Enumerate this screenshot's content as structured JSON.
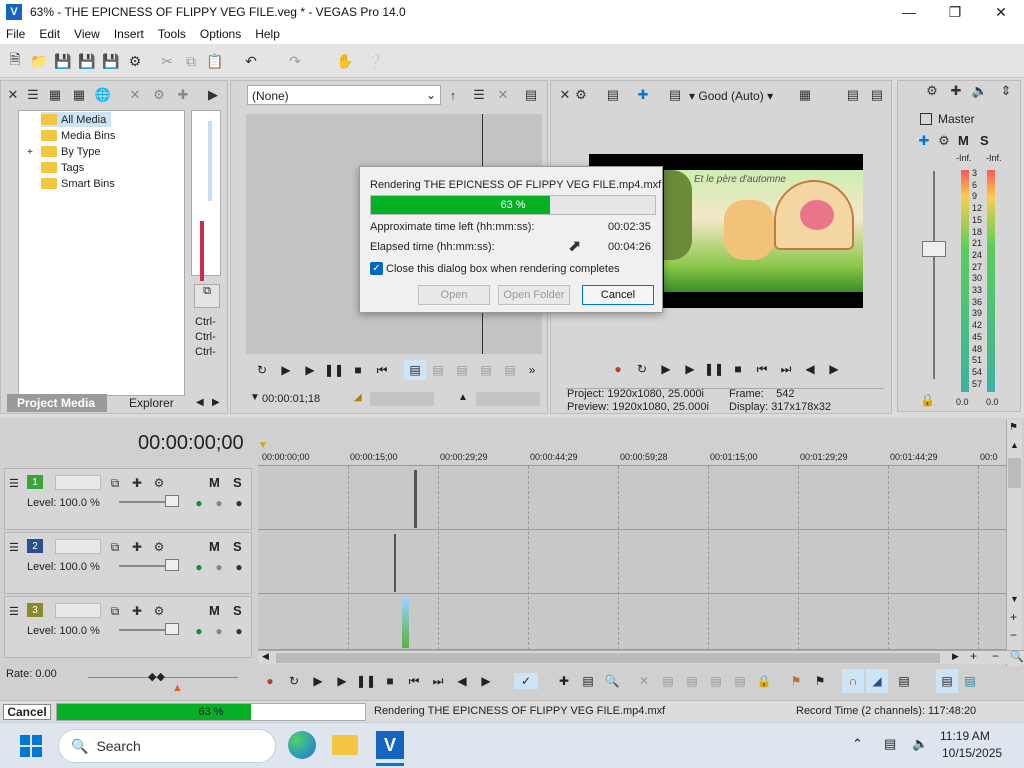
{
  "window": {
    "title": "63% - THE EPICNESS OF FLIPPY VEG FILE.veg * - VEGAS Pro 14.0",
    "app_icon": "vegas-logo-icon",
    "controls": [
      "minimize-icon",
      "maximize-icon",
      "close-icon"
    ]
  },
  "menu": [
    "File",
    "Edit",
    "View",
    "Insert",
    "Tools",
    "Options",
    "Help"
  ],
  "project_media": {
    "tree": [
      "All Media",
      "Media Bins",
      "By Type",
      "Tags",
      "Smart Bins"
    ],
    "tabs": [
      "Project Media",
      "Explorer"
    ],
    "side_labels": [
      "Ctrl-",
      "Ctrl-",
      "Ctrl-"
    ]
  },
  "trimmer": {
    "dropdown": "(None)",
    "timecode": "00:00:01;18"
  },
  "preview": {
    "quality": "Good (Auto)",
    "project_label": "Project:",
    "project_value": "1920x1080, 25.000i",
    "preview_label": "Preview:",
    "preview_value": "1920x1080, 25.000i",
    "frame_label": "Frame:",
    "frame_value": "542",
    "display_label": "Display:",
    "display_value": "317x178x32",
    "video_caption": "Et le père d'automne"
  },
  "mixer": {
    "title": "Master",
    "mute": "M",
    "solo": "S",
    "inf_left": "-Inf.",
    "inf_right": "-Inf.",
    "scale": [
      "3",
      "6",
      "9",
      "12",
      "15",
      "18",
      "21",
      "24",
      "27",
      "30",
      "33",
      "36",
      "39",
      "42",
      "45",
      "48",
      "51",
      "54",
      "57"
    ],
    "value_left": "0.0",
    "value_right": "0.0"
  },
  "render_dialog": {
    "title": "Rendering THE EPICNESS OF FLIPPY VEG FILE.mp4.mxf",
    "progress_text": "63 %",
    "progress_value": 63,
    "time_left_label": "Approximate time left (hh:mm:ss):",
    "time_left_value": "00:02:35",
    "elapsed_label": "Elapsed time (hh:mm:ss):",
    "elapsed_value": "00:04:26",
    "close_checkbox_label": "Close this dialog box when rendering completes",
    "close_checked": true,
    "buttons": {
      "open": "Open",
      "open_folder": "Open Folder",
      "cancel": "Cancel"
    }
  },
  "timeline": {
    "timecode": "00:00:00;00",
    "ruler": [
      "00:00:00;00",
      "00:00:15;00",
      "00:00:29;29",
      "00:00:44;29",
      "00:00:59;28",
      "00:01:15;00",
      "00:01:29;29",
      "00:01:44;29",
      "00:0"
    ],
    "tracks": [
      {
        "number": "1",
        "level": "Level: 100.0 %",
        "color": "#3ba33b"
      },
      {
        "number": "2",
        "level": "Level: 100.0 %",
        "color": "#2a4f8f"
      },
      {
        "number": "3",
        "level": "Level: 100.0 %",
        "color": "#8a8a2a"
      }
    ],
    "mute": "M",
    "solo": "S",
    "rate": "Rate: 0.00"
  },
  "statusbar": {
    "cancel": "Cancel",
    "progress_text": "63 %",
    "progress_value": 63,
    "message": "Rendering THE EPICNESS OF FLIPPY VEG FILE.mp4.mxf",
    "record_time": "Record Time (2 channels): 117:48:20"
  },
  "taskbar": {
    "search": "Search",
    "time": "11:19 AM",
    "date": "10/15/2025"
  },
  "colors": {
    "progress": "#06b025",
    "accent": "#0078d7"
  }
}
